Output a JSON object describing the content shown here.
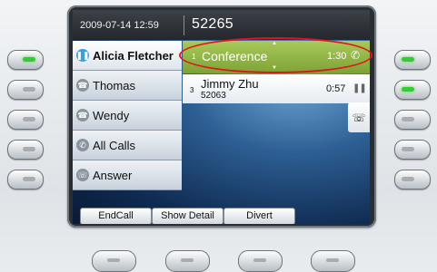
{
  "header": {
    "datetime": "2009-07-14 12:59",
    "extension": "52265"
  },
  "lines": [
    {
      "label": "Alicia Fletcher",
      "icon": "pause-icon",
      "selected": true
    },
    {
      "label": "Thomas",
      "icon": "handset-icon"
    },
    {
      "label": "Wendy",
      "icon": "handset-icon"
    },
    {
      "label": "All Calls",
      "icon": "all-calls-icon"
    },
    {
      "label": "Answer",
      "icon": "answer-icon"
    }
  ],
  "calls": {
    "active": {
      "index": "1",
      "name": "Conference",
      "duration": "1:30",
      "status_icon": "ringing-icon"
    },
    "held": {
      "index": "3",
      "name": "Jimmy Zhu",
      "number": "52063",
      "duration": "0:57",
      "status_icon": "pause-icon"
    }
  },
  "softkeys": [
    "EndCall",
    "Show Detail",
    "Divert"
  ],
  "colors": {
    "active_call": "#8db342",
    "lamp_on": "#33cc33",
    "annotation": "#e0141e",
    "selected_icon": "#3aa0dc"
  },
  "left_lamps_on": [
    true,
    false,
    false,
    false,
    false
  ],
  "right_lamps_on": [
    true,
    true,
    false,
    false,
    false
  ]
}
